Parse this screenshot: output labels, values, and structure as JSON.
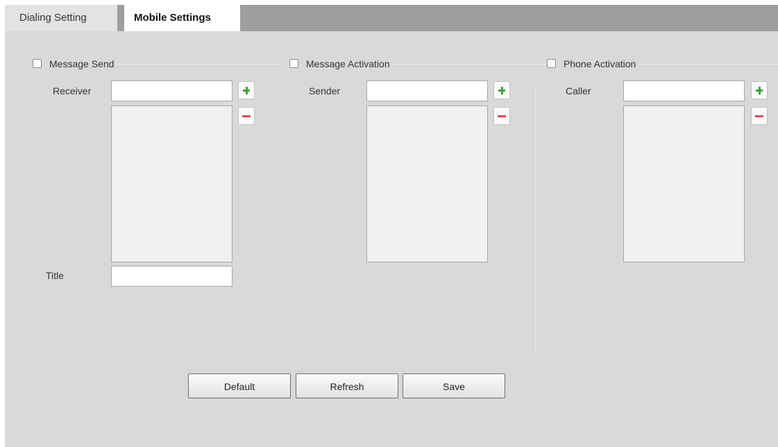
{
  "tabs": [
    {
      "label": "Dialing Setting",
      "active": false
    },
    {
      "label": "Mobile Settings",
      "active": true
    }
  ],
  "message_send": {
    "checkbox_label": "Message Send",
    "checked": false,
    "receiver_label": "Receiver",
    "receiver_value": "",
    "receiver_list": [],
    "title_label": "Title",
    "title_value": ""
  },
  "message_activation": {
    "checkbox_label": "Message Activation",
    "checked": false,
    "sender_label": "Sender",
    "sender_value": "",
    "sender_list": []
  },
  "phone_activation": {
    "checkbox_label": "Phone Activation",
    "checked": false,
    "caller_label": "Caller",
    "caller_value": "",
    "caller_list": []
  },
  "actions": {
    "default_label": "Default",
    "refresh_label": "Refresh",
    "save_label": "Save"
  },
  "icons": {
    "add": "plus-icon",
    "remove": "minus-icon"
  },
  "colors": {
    "add_icon": "#3aa53a",
    "remove_icon": "#e04a4a",
    "panel_bg": "#d9d9d9",
    "tabbar_bg": "#9e9e9e"
  }
}
